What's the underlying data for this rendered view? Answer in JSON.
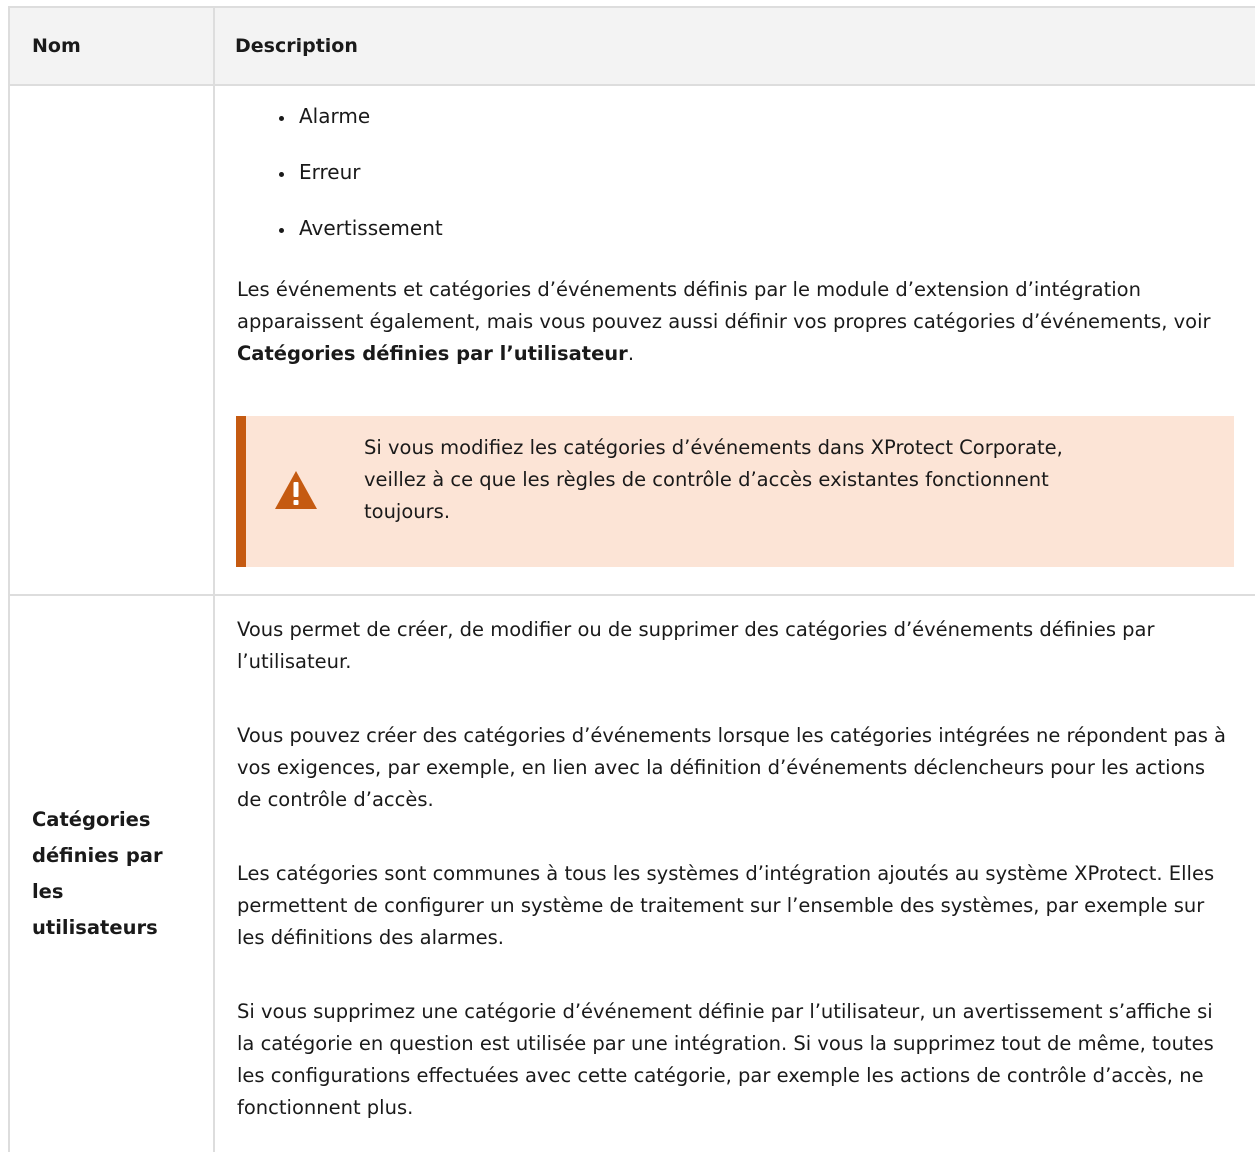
{
  "header": {
    "col_name": "Nom",
    "col_desc": "Description"
  },
  "row1": {
    "name": "",
    "bullets": [
      "Alarme",
      "Erreur",
      "Avertissement"
    ],
    "para_before": "Les événements et catégories d’événements définis par le module d’extension d’intégration apparaissent également, mais vous pouvez aussi définir vos propres catégories d’événements, voir ",
    "para_link": "Catégories définies par l’utilisateur",
    "para_after": ".",
    "warning": {
      "icon": "warning-triangle-icon",
      "color": "#c55a11",
      "background": "#fce4d6",
      "text": "Si vous modifiez les catégories d’événements dans XProtect Corporate, veillez à ce que les règles de contrôle d’accès existantes fonctionnent toujours."
    }
  },
  "row2": {
    "name": "Catégories définies par les utilisateurs",
    "paragraphs": [
      "Vous permet de créer, de modifier ou de supprimer des catégories d’événements définies par l’utilisateur.",
      "Vous pouvez créer des catégories d’événements lorsque les catégories intégrées ne répondent pas à vos exigences, par exemple, en lien avec la définition d’événements déclencheurs pour les actions de contrôle d’accès.",
      "Les catégories sont communes à tous les systèmes d’intégration ajoutés au système XProtect. Elles permettent de configurer un système de traitement sur l’ensemble des systèmes, par exemple sur les définitions des alarmes.",
      "Si vous supprimez une catégorie d’événement définie par l’utilisateur, un avertissement s’affiche si la catégorie en question est utilisée par une intégration. Si vous la supprimez tout de même, toutes les configurations effectuées avec cette catégorie, par exemple les actions de contrôle d’accès, ne fonctionnent plus."
    ]
  }
}
